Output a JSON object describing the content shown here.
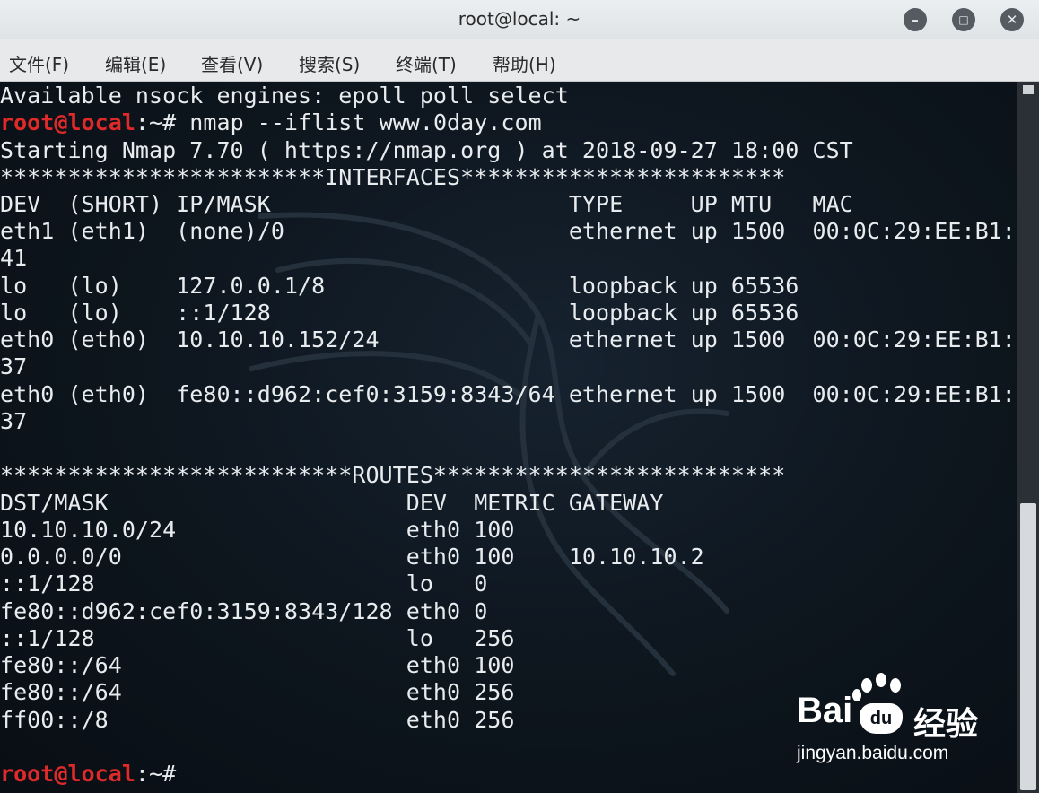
{
  "window": {
    "title": "root@local: ~",
    "minimize_icon": "minimize-icon",
    "maximize_icon": "maximize-icon",
    "close_icon": "close-icon"
  },
  "menu": [
    {
      "label": "文件(F)"
    },
    {
      "label": "编辑(E)"
    },
    {
      "label": "查看(V)"
    },
    {
      "label": "搜索(S)"
    },
    {
      "label": "终端(T)"
    },
    {
      "label": "帮助(H)"
    }
  ],
  "prompt": {
    "user": "root@local",
    "path": ":~# "
  },
  "terminal": {
    "lines": [
      "Available nsock engines: epoll poll select",
      "",
      "Starting Nmap 7.70 ( https://nmap.org ) at 2018-09-27 18:00 CST",
      "************************INTERFACES************************",
      "DEV  (SHORT) IP/MASK                      TYPE     UP MTU   MAC",
      "eth1 (eth1)  (none)/0                     ethernet up 1500  00:0C:29:EE:B1:",
      "41",
      "lo   (lo)    127.0.0.1/8                  loopback up 65536",
      "lo   (lo)    ::1/128                      loopback up 65536",
      "eth0 (eth0)  10.10.10.152/24              ethernet up 1500  00:0C:29:EE:B1:",
      "37",
      "eth0 (eth0)  fe80::d962:cef0:3159:8343/64 ethernet up 1500  00:0C:29:EE:B1:",
      "37",
      "",
      "**************************ROUTES**************************",
      "DST/MASK                      DEV  METRIC GATEWAY",
      "10.10.10.0/24                 eth0 100",
      "0.0.0.0/0                     eth0 100    10.10.10.2",
      "::1/128                       lo   0",
      "fe80::d962:cef0:3159:8343/128 eth0 0",
      "::1/128                       lo   256",
      "fe80::/64                     eth0 100",
      "fe80::/64                     eth0 256",
      "ff00::/8                      eth0 256",
      "",
      ""
    ],
    "command": "nmap --iflist www.0day.com"
  },
  "watermark": {
    "brand_left": "Bai",
    "brand_mid": "du",
    "brand_cn": "经验",
    "url": "jingyan.baidu.com"
  },
  "colors": {
    "prompt_user": "#e02a2a",
    "terminal_bg": "#0d151d",
    "terminal_fg": "#e8ecef"
  }
}
